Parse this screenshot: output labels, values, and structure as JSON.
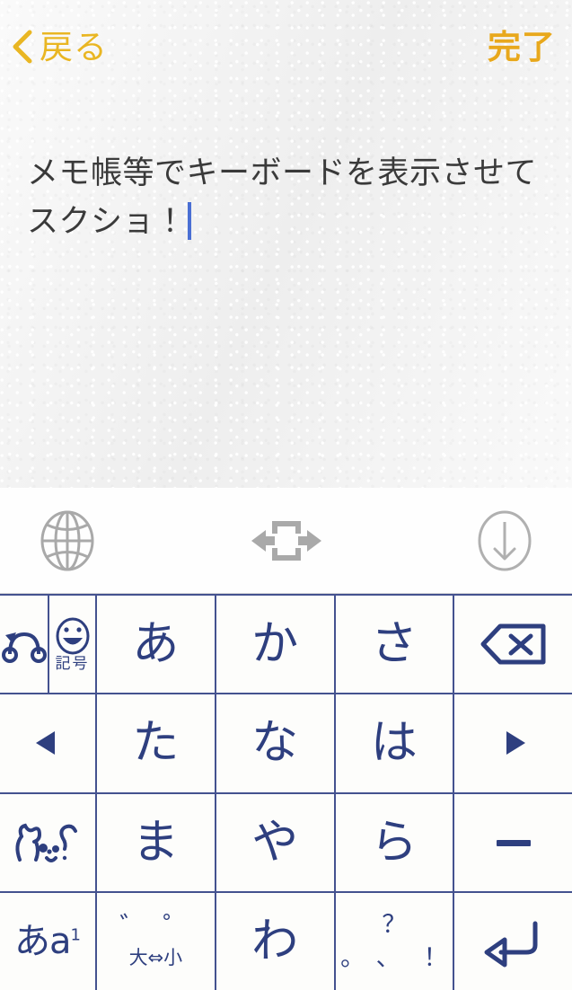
{
  "nav": {
    "back_label": "戻る",
    "back_icon": "chevron-left-icon",
    "done_label": "完了",
    "accent_color": "#e9b623"
  },
  "note": {
    "text": "メモ帳等でキーボードを表示させてスクショ！",
    "caret_color": "#4a6fd4",
    "background_color": "#f1f1f1",
    "text_color": "#3a3a3a"
  },
  "keyboard": {
    "key_color": "#2e3f7f",
    "grid_line_color": "#44528f",
    "key_background": "#fdfdfb",
    "toolbar": [
      {
        "name": "globe-icon",
        "label": "",
        "position": "left"
      },
      {
        "name": "keyboard-width-toggle-icon",
        "label": "",
        "position": "center"
      },
      {
        "name": "hide-keyboard-icon",
        "label": "",
        "position": "right"
      }
    ],
    "toolbar_icon_color": "#a8a8a8",
    "rows": [
      {
        "keys": [
          {
            "name": "undo-key",
            "type": "icon",
            "icon": "undo-icon",
            "label": "",
            "width": "narrow"
          },
          {
            "name": "symbol-key",
            "type": "icon-label",
            "icon": "emoji-face-icon",
            "label": "記号",
            "width": "sym"
          },
          {
            "name": "kana-key-a",
            "type": "kana",
            "label": "あ",
            "width": "col"
          },
          {
            "name": "kana-key-ka",
            "type": "kana",
            "label": "か",
            "width": "col"
          },
          {
            "name": "kana-key-sa",
            "type": "kana",
            "label": "さ",
            "width": "col"
          },
          {
            "name": "backspace-key",
            "type": "icon",
            "icon": "backspace-icon",
            "label": "",
            "width": "col"
          }
        ]
      },
      {
        "keys": [
          {
            "name": "cursor-left-key",
            "type": "icon",
            "icon": "triangle-left-icon",
            "label": "",
            "width": "wide"
          },
          {
            "name": "kana-key-ta",
            "type": "kana",
            "label": "た",
            "width": "col"
          },
          {
            "name": "kana-key-na",
            "type": "kana",
            "label": "な",
            "width": "col"
          },
          {
            "name": "kana-key-ha",
            "type": "kana",
            "label": "は",
            "width": "col"
          },
          {
            "name": "cursor-right-key",
            "type": "icon",
            "icon": "triangle-right-icon",
            "label": "",
            "width": "col"
          }
        ]
      },
      {
        "keys": [
          {
            "name": "kaomoji-key",
            "type": "icon",
            "icon": "kaomoji-face-icon",
            "label": "",
            "width": "wide"
          },
          {
            "name": "kana-key-ma",
            "type": "kana",
            "label": "ま",
            "width": "col"
          },
          {
            "name": "kana-key-ya",
            "type": "kana",
            "label": "や",
            "width": "col"
          },
          {
            "name": "kana-key-ra",
            "type": "kana",
            "label": "ら",
            "width": "col"
          },
          {
            "name": "dash-key",
            "type": "icon",
            "icon": "minus-icon",
            "label": "ー",
            "width": "col"
          }
        ]
      },
      {
        "keys": [
          {
            "name": "input-mode-key",
            "type": "mode",
            "label": "あa",
            "sublabel": "1",
            "width": "wide"
          },
          {
            "name": "dakuten-key",
            "type": "dakuten",
            "label": "゛゜",
            "sublabel": "大⇔小",
            "width": "col"
          },
          {
            "name": "kana-key-wa",
            "type": "kana",
            "label": "わ",
            "width": "col"
          },
          {
            "name": "punctuation-key",
            "type": "punct",
            "label": "？",
            "sublabel": "。、！",
            "width": "col"
          },
          {
            "name": "return-key",
            "type": "icon",
            "icon": "return-arrow-icon",
            "label": "",
            "width": "col"
          }
        ]
      }
    ]
  }
}
